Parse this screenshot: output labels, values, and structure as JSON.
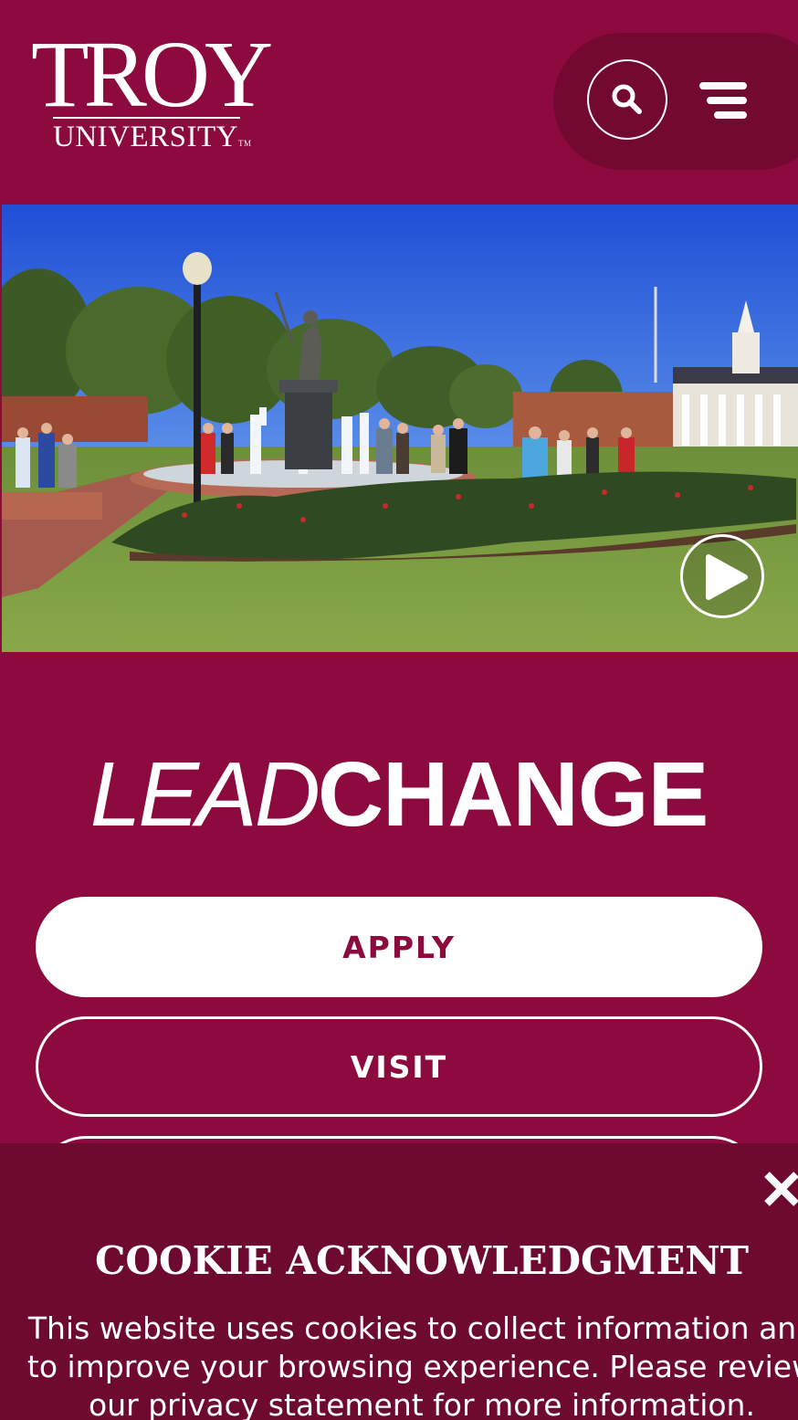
{
  "header": {
    "logo_word": "TROY",
    "logo_sub": "UNIVERSITY",
    "logo_tm": "TM",
    "search_icon": "search-icon",
    "menu_icon": "hamburger-menu-icon"
  },
  "hero": {
    "image_alt": "Campus fountain with statue and students",
    "play_icon": "play-icon"
  },
  "tagline": {
    "lead": "LEAD",
    "change": "CHANGE"
  },
  "actions": {
    "apply": "APPLY",
    "visit": "VISIT"
  },
  "cookie": {
    "title": "COOKIE ACKNOWLEDGMENT",
    "text": "This website uses cookies to collect information and to improve your browsing experience. Please review our privacy statement for more information.",
    "close_icon": "close-icon"
  },
  "colors": {
    "brand": "#8c0a3e",
    "brand_dark": "#730831",
    "banner": "#6e0930"
  }
}
